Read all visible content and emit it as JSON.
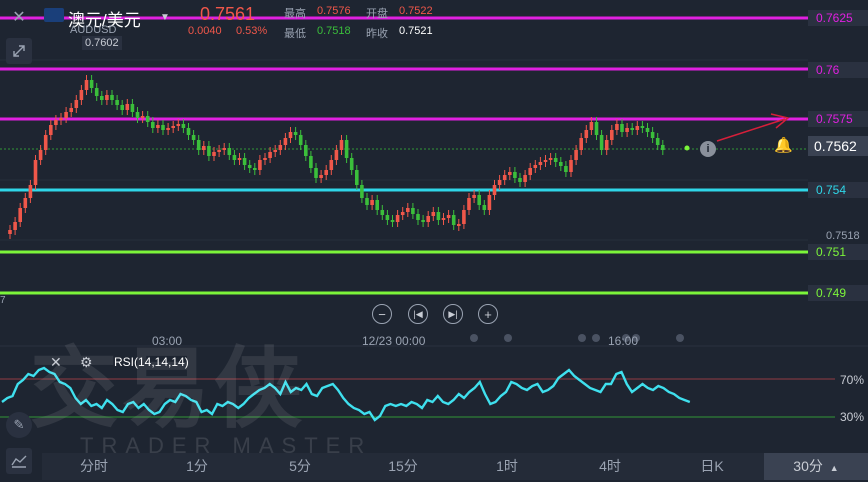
{
  "header": {
    "symbol_name": "澳元/美元",
    "symbol_code": "AUDUSD",
    "price": "0.7561",
    "change": "0.0040",
    "change_pct": "0.53%",
    "high_label": "最高",
    "high_value": "0.7576",
    "open_label": "开盘",
    "open_value": "0.7522",
    "low_label": "最低",
    "low_value": "0.7518",
    "prev_close_label": "昨收",
    "prev_close_value": "0.7521",
    "max_marker": "0.7602"
  },
  "price_axis": {
    "levels": [
      "0.7625",
      "0.76",
      "0.7575",
      "0.754",
      "0.751",
      "0.749"
    ],
    "current": "0.7562",
    "min_marker": "0.7518",
    "left_edge_label": "7"
  },
  "time_axis": [
    "03:00",
    "12/23 00:00",
    "16:00"
  ],
  "indicator": {
    "label": "RSI(14,14,14)",
    "upper": "70%",
    "lower": "30%"
  },
  "tabs": [
    {
      "label": "分时",
      "active": false
    },
    {
      "label": "1分",
      "active": false
    },
    {
      "label": "5分",
      "active": false
    },
    {
      "label": "15分",
      "active": false
    },
    {
      "label": "1时",
      "active": false
    },
    {
      "label": "4时",
      "active": false
    },
    {
      "label": "日K",
      "active": false
    },
    {
      "label": "30分",
      "active": true
    }
  ],
  "active_tab_arrow": "▲",
  "watermark": {
    "logo": "交易侠",
    "brand": "TRADER MASTER"
  },
  "colors": {
    "background": "#1e2531",
    "up": "#f0574a",
    "down": "#3bbf3b",
    "magenta_line": "#e020e0",
    "cyan_line": "#2fd6e8",
    "green_line": "#7cf53a",
    "rsi_line": "#3fe0ee"
  },
  "icons": [
    "close-icon",
    "collapse-icon",
    "chevron-down-icon",
    "zoom-out-icon",
    "prev-icon",
    "next-icon",
    "zoom-in-icon",
    "bell-icon",
    "info-icon",
    "gear-icon",
    "pencil-icon",
    "indicator-icon"
  ]
}
